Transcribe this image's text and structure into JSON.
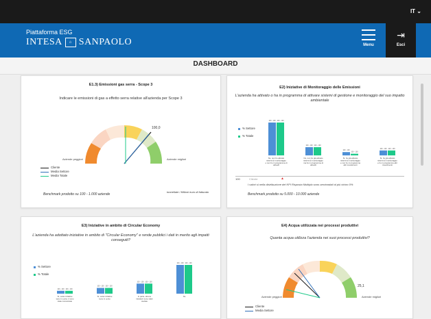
{
  "topbar": {
    "language": "IT"
  },
  "header": {
    "platform": "Piattaforma ESG",
    "brand_left": "INTESA",
    "brand_right": "SANPAOLO",
    "menu_label": "Menu",
    "exit_label": "Esci"
  },
  "page": {
    "title": "DASHBOARD"
  },
  "panels": {
    "p1": {
      "title": "E1.3) Emissioni gas serra - Scope 3",
      "question": "Indicare le emissioni di gas a effetto serra relative all'azienda per Scope 3",
      "gauge_value": "100,0",
      "gauge_left": "Aziende peggiori",
      "gauge_right": "Aziende migliori",
      "legend": [
        "Cliente",
        "Media Settore",
        "Media Totale"
      ],
      "benchmark": "Benchmark prodotto su 100 - 1.000 aziende",
      "unit": "tonnellate / Milioni euro di fatturato"
    },
    "p2": {
      "title": "E2) Iniziative di Monitoraggio delle Emissioni",
      "question": "L'azienda ha attivato o ha in programma di attivare sistemi di gestione e monitoraggio del suo impatto ambientale",
      "legend": [
        "% Settore",
        "% Totale"
      ],
      "bar_labels": [
        "100 - 100",
        "100 - 100",
        "100 - 100",
        "100 - 100",
        "100 - 100",
        "100 - 100",
        "100 - 100",
        "100 - 100"
      ],
      "categories": [
        "No, non ho attivato sistemi di monitoraggio e non ho in programma di attivarli",
        "No, non ho già attivato sistemi di monitoraggio ma ho in programma di attivarli",
        "Sì, ho già attivato sistemi di monitoraggio e non ho in programma altri investimenti",
        "Sì, ho già attivato sistemi di monitoraggio e ho in programma altri investimenti"
      ],
      "axis_left": "100",
      "client_label": "Cliente",
      "note": "I valori si nella distribuzione del KPI Risposta Multipla sono arrotondati al più vicino 0%",
      "benchmark": "Benchmark prodotto su 5.000 - 10.000 aziende"
    },
    "p3": {
      "title": "E3) Iniziative in ambito di Circular Economy",
      "question": "L'azienda ha adottato iniziative in ambito di \"Circular Economy\" e rende pubblici i dati in merito agli impatti conseguiti?",
      "legend": [
        "% Settore",
        "% Totale"
      ],
      "bar_labels": [
        "100 - 100",
        "100 - 100",
        "100 - 100",
        "100 - 100",
        "100 - 100",
        "100 - 100",
        "100 - 100",
        "100 - 100"
      ],
      "categories": [
        "Sì, varie iniziative sono in corso e sono state comunicate",
        "Sì, varie iniziative sono in corso",
        "In parte, alcune iniziative sono state avviate",
        "No"
      ]
    },
    "p4": {
      "title": "E4) Acqua utilizzata nei processi produttivi",
      "question": "Quanta acqua utilizza l'azienda nei suoi processi produttivi?",
      "gauge_value": "25,1",
      "gauge_left": "Aziende peggiori",
      "gauge_right": "Aziende migliori",
      "legend": [
        "Cliente",
        "Media Settore"
      ]
    }
  },
  "chart_data": [
    {
      "type": "bar",
      "title": "E2) Iniziative di Monitoraggio delle Emissioni",
      "categories": [
        "No, non ho attivato sistemi di monitoraggio e non ho in programma di attivarli",
        "No, non ho già attivato sistemi di monitoraggio ma ho in programma di attivarli",
        "Sì, ho già attivato sistemi di monitoraggio e non ho in programma altri investimenti",
        "Sì, ho già attivato sistemi di monitoraggio e ho in programma altri investimenti"
      ],
      "series": [
        {
          "name": "% Settore",
          "values": [
            100,
            25,
            10,
            15
          ]
        },
        {
          "name": "% Totale",
          "values": [
            100,
            25,
            5,
            15
          ]
        }
      ]
    },
    {
      "type": "bar",
      "title": "E3) Iniziative in ambito di Circular Economy",
      "categories": [
        "Sì, varie iniziative sono in corso e sono state comunicate",
        "Sì, varie iniziative sono in corso",
        "In parte, alcune iniziative sono state avviate",
        "No"
      ],
      "series": [
        {
          "name": "% Settore",
          "values": [
            10,
            20,
            35,
            100
          ]
        },
        {
          "name": "% Totale",
          "values": [
            10,
            20,
            35,
            100
          ]
        }
      ]
    }
  ],
  "colors": {
    "blue": "#0f69b4",
    "bar_blue": "#4d8fd6",
    "bar_green": "#1ec98a"
  }
}
